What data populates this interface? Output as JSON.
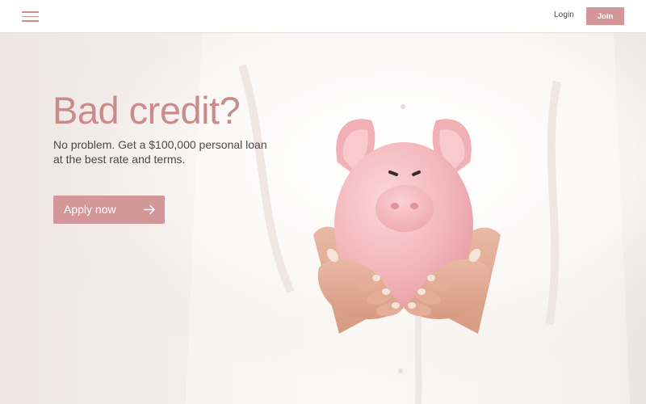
{
  "header": {
    "menu_icon": "hamburger-menu-icon",
    "login_label": "Login",
    "join_label": "Join"
  },
  "hero": {
    "headline": "Bad credit?",
    "subtext": "No problem. Get a $100,000 personal loan at the best rate and terms.",
    "cta_label": "Apply now",
    "cta_icon": "arrow-right-icon",
    "image_subject": "piggy-bank-in-hands"
  },
  "colors": {
    "accent": "#d3979a",
    "headline": "#c98c8c",
    "text": "#4a4a4a",
    "piggy": "#f2b9bd"
  }
}
